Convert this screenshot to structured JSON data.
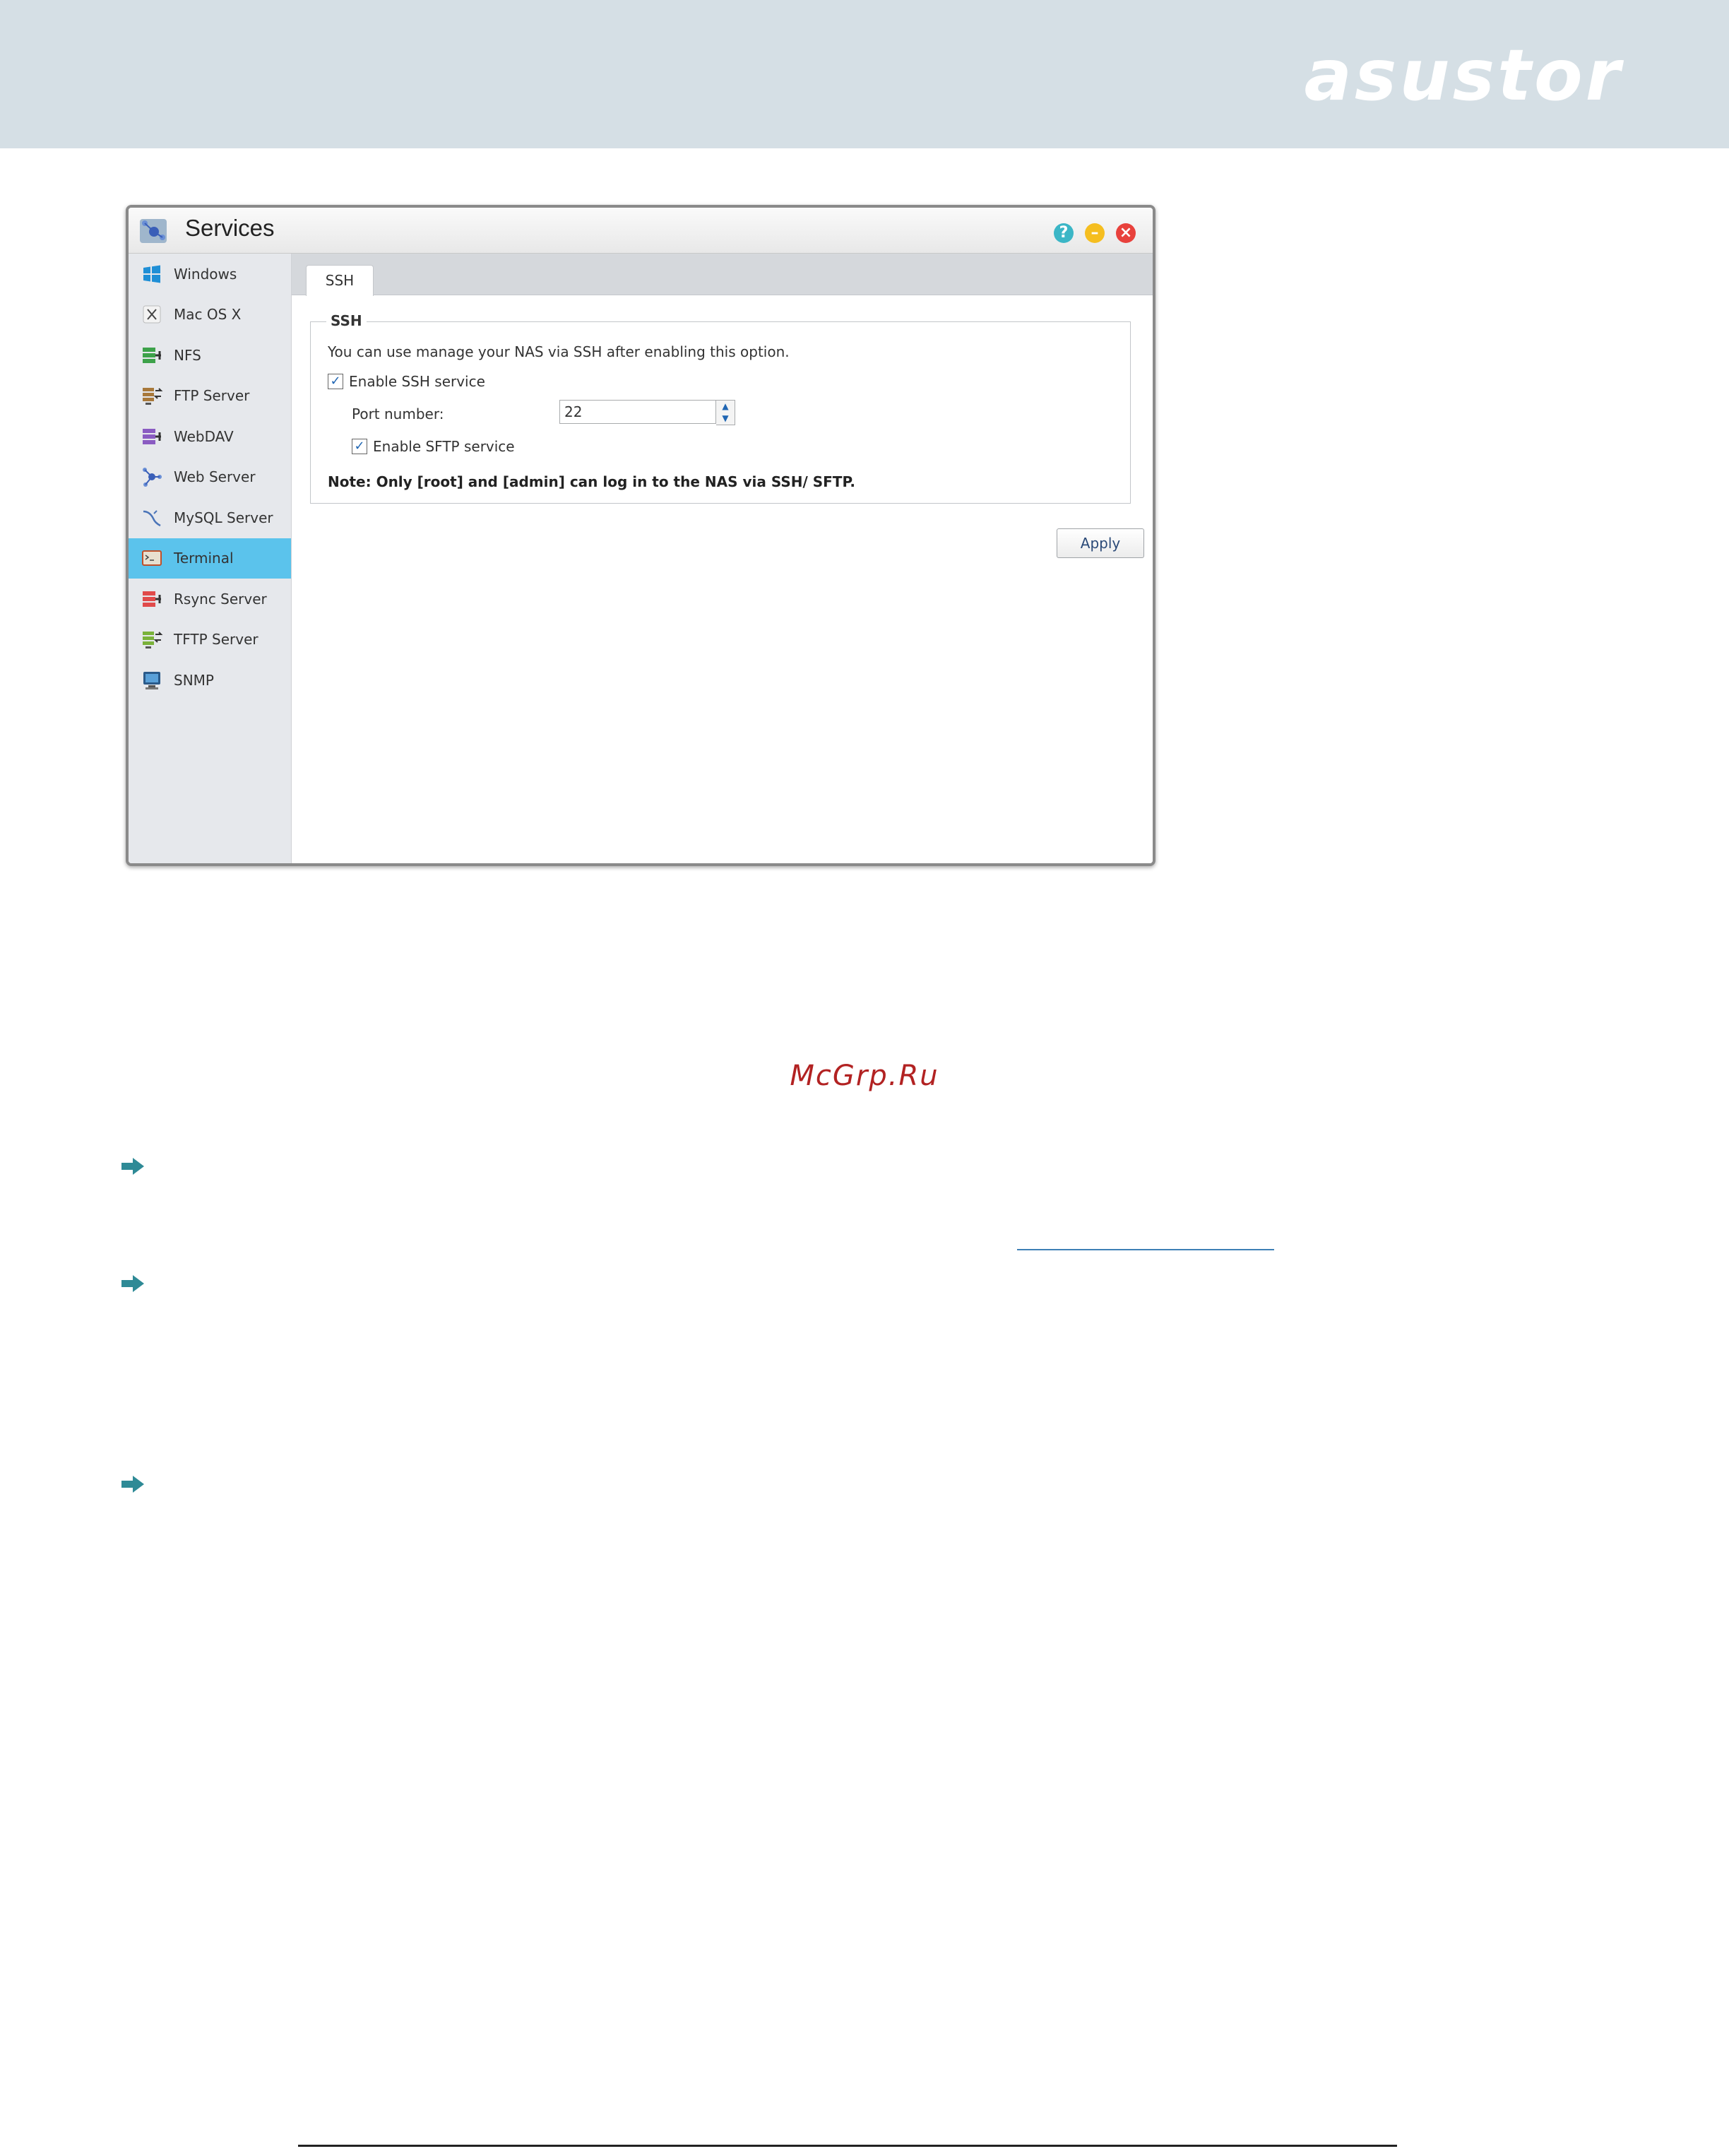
{
  "brand": {
    "logo": "asustor"
  },
  "window": {
    "title": "Services",
    "title_icon": "services-icon",
    "controls": {
      "help": "?",
      "minimize": "–",
      "close": "×"
    }
  },
  "sidebar": {
    "items": [
      {
        "label": "Windows",
        "icon": "windows-icon",
        "active": false
      },
      {
        "label": "Mac OS X",
        "icon": "macosx-icon",
        "active": false
      },
      {
        "label": "NFS",
        "icon": "nfs-icon",
        "active": false
      },
      {
        "label": "FTP Server",
        "icon": "ftp-server-icon",
        "active": false
      },
      {
        "label": "WebDAV",
        "icon": "webdav-icon",
        "active": false
      },
      {
        "label": "Web Server",
        "icon": "web-server-icon",
        "active": false
      },
      {
        "label": "MySQL Server",
        "icon": "mysql-server-icon",
        "active": false
      },
      {
        "label": "Terminal",
        "icon": "terminal-icon",
        "active": true
      },
      {
        "label": "Rsync Server",
        "icon": "rsync-server-icon",
        "active": false
      },
      {
        "label": "TFTP Server",
        "icon": "tftp-server-icon",
        "active": false
      },
      {
        "label": "SNMP",
        "icon": "snmp-icon",
        "active": false
      }
    ]
  },
  "main": {
    "tab_label": "SSH",
    "ssh": {
      "legend": "SSH",
      "description": "You can use manage your NAS via SSH after enabling this option.",
      "enable_ssh_label": "Enable SSH service",
      "enable_ssh_checked": true,
      "port_label": "Port number:",
      "port_value": "22",
      "enable_sftp_label": "Enable SFTP service",
      "enable_sftp_checked": true,
      "note": "Note: Only [root] and [admin] can log in to the NAS via SSH/ SFTP."
    },
    "apply_label": "Apply"
  },
  "watermark": "McGrp.Ru",
  "colors": {
    "header_band": "#d5dfe5",
    "active_item": "#5bc3ec",
    "arrow": "#2e8a96",
    "watermark": "#b22222"
  }
}
